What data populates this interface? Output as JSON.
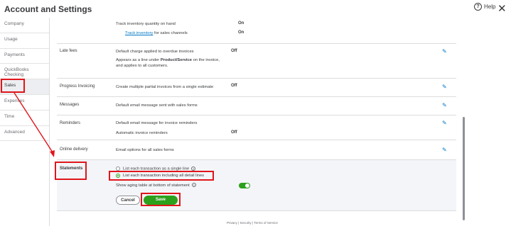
{
  "header": {
    "title": "Account and Settings",
    "help_label": "Help"
  },
  "sidebar": {
    "items": [
      {
        "label": "Company"
      },
      {
        "label": "Usage"
      },
      {
        "label": "Payments"
      },
      {
        "label": "QuickBooks Checking"
      },
      {
        "label": "Sales"
      },
      {
        "label": "Expenses"
      },
      {
        "label": "Time"
      },
      {
        "label": "Advanced"
      }
    ]
  },
  "inventory": {
    "track_qty": "Track inventory quantity on hand",
    "track_qty_value": "On",
    "track_channels_link": "Track inventory",
    "track_channels_rest": " for sales channels",
    "track_channels_value": "On"
  },
  "late_fees": {
    "label": "Late fees",
    "desc": "Default charge applied to overdue invoices",
    "value": "Off",
    "note_prefix": "Appears as a line under ",
    "note_bold": "Product/Service",
    "note_suffix": " on the invoice,",
    "note_line2": "and applies to all customers."
  },
  "progress_invoicing": {
    "label": "Progress Invoicing",
    "desc": "Create multiple partial invoices from a single estimate",
    "value": "Off"
  },
  "messages": {
    "label": "Messages",
    "desc": "Default email message sent with sales forms"
  },
  "reminders": {
    "label": "Reminders",
    "desc": "Default email message for invoice reminders",
    "desc2": "Automatic invoice reminders",
    "value2": "Off"
  },
  "online_delivery": {
    "label": "Online delivery",
    "desc": "Email options for all sales forms"
  },
  "statements": {
    "label": "Statements",
    "option1": "List each transaction as a single line",
    "option2": "List each transaction including all detail lines",
    "aging_label": "Show aging table at bottom of statement",
    "aging_enabled": true,
    "cancel_label": "Cancel",
    "save_label": "Save"
  },
  "footer": {
    "privacy": "Privacy",
    "security": "Security",
    "terms": "Terms of Service",
    "separator": "|"
  },
  "colors": {
    "accent_green": "#2ca01c",
    "link_blue": "#0077c5",
    "annotation_red": "#e0151b"
  }
}
